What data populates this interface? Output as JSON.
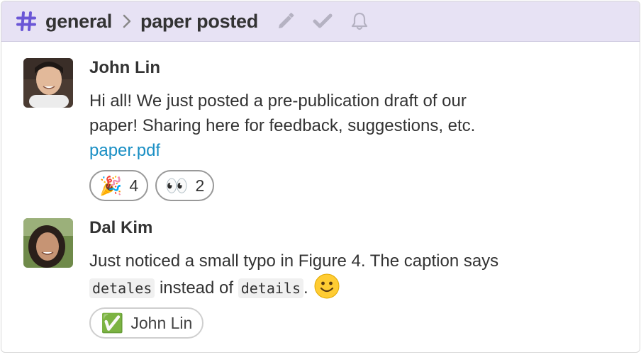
{
  "header": {
    "channel": "general",
    "topic": "paper posted",
    "icons": [
      "hash-icon",
      "chevron-right-icon",
      "pencil-icon",
      "checkmark-icon",
      "bell-icon"
    ],
    "colors": {
      "background": "#e7e2f4",
      "hash": "#6b57d6",
      "icon": "#b5b2c2"
    }
  },
  "messages": [
    {
      "sender": "John Lin",
      "text_line1": "Hi all! We just posted a pre-publication draft of our",
      "text_line2": "paper! Sharing here for feedback, suggestions, etc.",
      "attachment": "paper.pdf",
      "reactions": [
        {
          "emoji": "🎉",
          "count": "4"
        },
        {
          "emoji": "👀",
          "count": "2"
        }
      ]
    },
    {
      "sender": "Dal Kim",
      "text_line1": "Just noticed a small typo in Figure 4. The caption says",
      "code1": "detales",
      "text_mid": " instead of ",
      "code2": "details",
      "text_end": ".",
      "reactions": [
        {
          "emoji": "✅",
          "label": "John Lin"
        }
      ]
    }
  ],
  "colors": {
    "link": "#1a8fc4",
    "text": "#333333"
  }
}
